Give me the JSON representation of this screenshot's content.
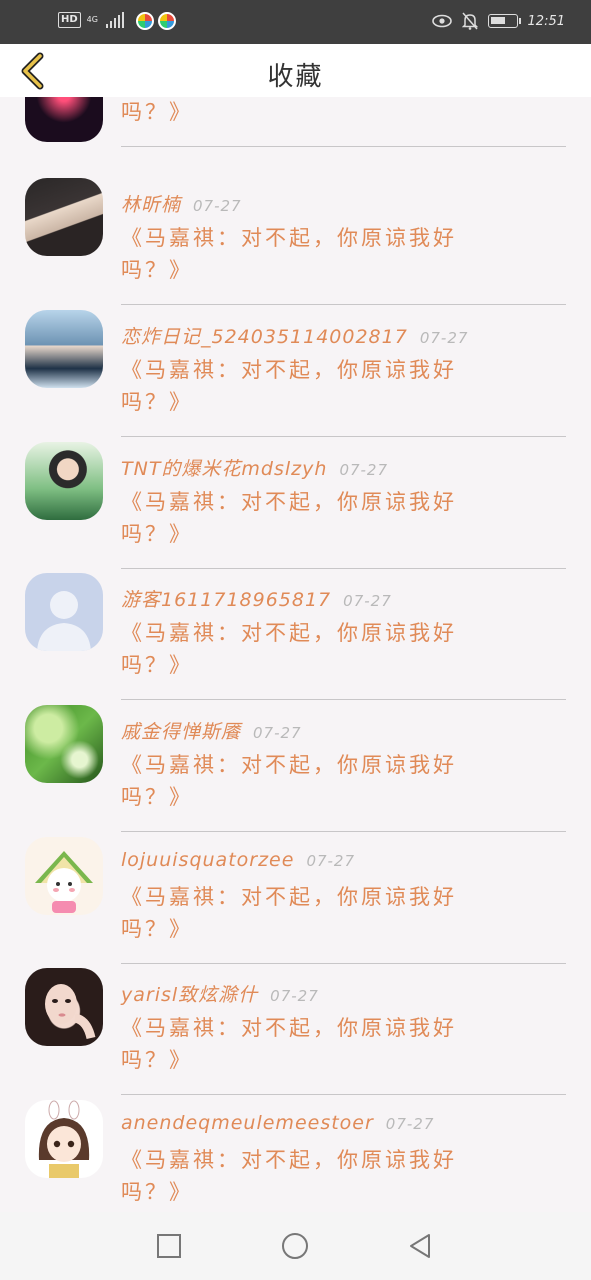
{
  "status": {
    "time": "12:51",
    "hd": "HD",
    "network": "4G",
    "battery_level": 0.6
  },
  "header": {
    "title": "收藏",
    "back_icon": "chevron-left-icon"
  },
  "items": [
    {
      "name": "",
      "date": "",
      "message": "《马嘉祺：对不起，你原谅我好吗？》",
      "avatar": "fireworks"
    },
    {
      "name": "林昕楠",
      "date": "07-27",
      "message": "《马嘉祺：对不起，你原谅我好吗？》",
      "avatar": "girl-dark"
    },
    {
      "name": "恋炸日记_524035114002817",
      "date": "07-27",
      "message": "《马嘉祺：对不起，你原谅我好吗？》",
      "avatar": "boy-blue"
    },
    {
      "name": "TNT的爆米花mdslzyh",
      "date": "07-27",
      "message": "《马嘉祺：对不起，你原谅我好吗？》",
      "avatar": "boy-green"
    },
    {
      "name": "游客1611718965817",
      "date": "07-27",
      "message": "《马嘉祺：对不起，你原谅我好吗？》",
      "avatar": "default"
    },
    {
      "name": "戚金得惮斯餍",
      "date": "07-27",
      "message": "《马嘉祺：对不起，你原谅我好吗？》",
      "avatar": "glass-green"
    },
    {
      "name": "lojuuisquatorzee",
      "date": "07-27",
      "message": "《马嘉祺：对不起，你原谅我好吗？》",
      "avatar": "watermelon"
    },
    {
      "name": "yarisl致炫滁什",
      "date": "07-27",
      "message": "《马嘉祺：对不起，你原谅我好吗？》",
      "avatar": "girl-face"
    },
    {
      "name": "anendeqmeulemeestoer",
      "date": "07-27",
      "message": "《马嘉祺：对不起，你原谅我好吗？》",
      "avatar": "anime-girl"
    }
  ],
  "navbar": {
    "square_icon": "recent-apps-icon",
    "circle_icon": "home-icon",
    "triangle_icon": "back-icon"
  }
}
